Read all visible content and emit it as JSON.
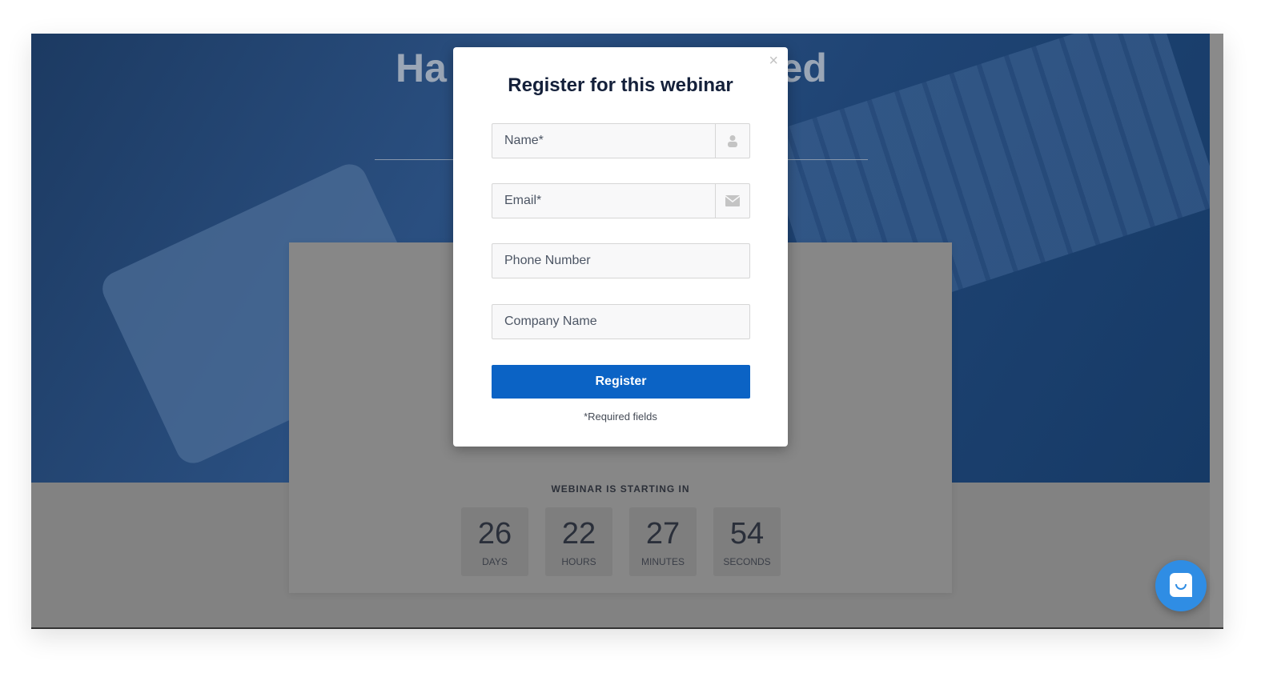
{
  "hero": {
    "title_left": "Ha",
    "title_right": "ned"
  },
  "countdown": {
    "heading": "WEBINAR IS STARTING IN",
    "units": [
      {
        "value": "26",
        "label": "DAYS"
      },
      {
        "value": "22",
        "label": "HOURS"
      },
      {
        "value": "27",
        "label": "MINUTES"
      },
      {
        "value": "54",
        "label": "SECONDS"
      }
    ]
  },
  "modal": {
    "title": "Register for this webinar",
    "close": "×",
    "fields": [
      {
        "placeholder": "Name*",
        "icon": "user-icon"
      },
      {
        "placeholder": "Email*",
        "icon": "envelope-icon"
      },
      {
        "placeholder": "Phone Number"
      },
      {
        "placeholder": "Company Name"
      }
    ],
    "submit": "Register",
    "note": "*Required fields"
  },
  "colors": {
    "accent": "#0b63c5",
    "chat": "#2f8de4"
  }
}
